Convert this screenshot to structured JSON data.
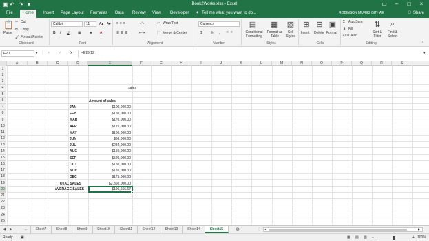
{
  "window": {
    "title": "Book2Works.xlsx - Excel",
    "user": "ROBINSON MURIKI GITHAE",
    "share_label": "Share",
    "tell_me": "Tell me what you want to do..."
  },
  "ribbon_tabs": [
    "File",
    "Home",
    "Insert",
    "Page Layout",
    "Formulas",
    "Data",
    "Review",
    "View",
    "Developer"
  ],
  "ribbon": {
    "clipboard": {
      "paste": "Paste",
      "cut": "Cut",
      "copy": "Copy",
      "format_painter": "Format Painter",
      "group": "Clipboard"
    },
    "font": {
      "name": "Calibri",
      "size": "11",
      "bold": "B",
      "italic": "I",
      "underline": "U",
      "group": "Font"
    },
    "alignment": {
      "wrap": "Wrap Text",
      "merge": "Merge & Center",
      "group": "Alignment"
    },
    "number": {
      "format": "Currency",
      "currency": "$",
      "percent": "%",
      "comma": ",",
      "group": "Number"
    },
    "styles": {
      "conditional": "Conditional Formatting",
      "format_as": "Format as Table",
      "cell_styles": "Cell Styles",
      "group": "Styles"
    },
    "cells": {
      "insert": "Insert",
      "delete": "Delete",
      "format": "Format",
      "group": "Cells"
    },
    "editing": {
      "autosum": "AutoSum",
      "fill": "Fill",
      "clear": "Clear",
      "sort": "Sort & Filter",
      "find": "Find & Select",
      "group": "Editing"
    }
  },
  "formula_bar": {
    "name_box": "E20",
    "cancel": "×",
    "enter": "✓",
    "fx": "fx",
    "formula": "=E19/12"
  },
  "columns": [
    "A",
    "B",
    "C",
    "D",
    "E",
    "F",
    "G",
    "H",
    "I",
    "J",
    "K",
    "L",
    "M",
    "N",
    "O",
    "P",
    "Q",
    "R",
    "S"
  ],
  "selected_column": "E",
  "rows": [
    "1",
    "2",
    "3",
    "4",
    "5",
    "6",
    "7",
    "8",
    "9",
    "10",
    "11",
    "12",
    "13",
    "14",
    "15",
    "16",
    "17",
    "18",
    "19",
    "20",
    "21",
    "22",
    "23",
    "24",
    "25"
  ],
  "selected_row": "20",
  "sheet": {
    "heading": "sales",
    "col_header": "Amount of sales",
    "months": [
      {
        "label": "JAN",
        "value": "$100,000.00"
      },
      {
        "label": "FEB",
        "value": "$150,000.00"
      },
      {
        "label": "MAR",
        "value": "$170,000.00"
      },
      {
        "label": "APR",
        "value": "$175,000.00"
      },
      {
        "label": "MAY",
        "value": "$100,000.00"
      },
      {
        "label": "JUN",
        "value": "$66,000.00"
      },
      {
        "label": "JUL",
        "value": "$234,000.00"
      },
      {
        "label": "AUG",
        "value": "$150,000.00"
      },
      {
        "label": "SEP",
        "value": "$520,000.00"
      },
      {
        "label": "OCT",
        "value": "$150,000.00"
      },
      {
        "label": "NOV",
        "value": "$170,000.00"
      },
      {
        "label": "DEC",
        "value": "$175,000.00"
      }
    ],
    "total_label": "TOTAL SALES",
    "total_value": "$2,360,000.00",
    "avg_label": "AVERAGE SALES",
    "avg_value": "$196,666.67"
  },
  "sheet_tabs": [
    "...",
    "Sheet7",
    "Sheet8",
    "Sheet9",
    "Sheet10",
    "Sheet11",
    "Sheet12",
    "Sheet13",
    "Sheet14",
    "Sheet15"
  ],
  "active_sheet": "Sheet15",
  "status": {
    "ready": "Ready",
    "zoom": "100%"
  },
  "colors": {
    "accent": "#217346"
  }
}
